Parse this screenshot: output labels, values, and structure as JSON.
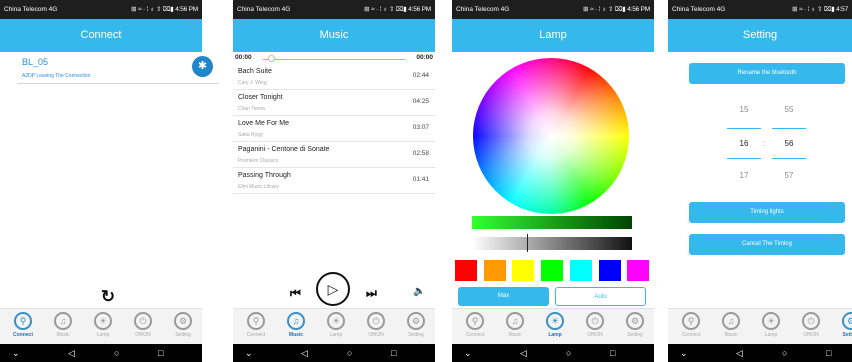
{
  "statusbar": {
    "carrier": "China Telecom 4G",
    "signal": "⊞ ≈ · ⁞ ♁ ⇧ ⌧▮",
    "time1": "4:56 PM",
    "time2": "4:56 PM",
    "time3": "4:56 PM",
    "time4": "4:57"
  },
  "connect": {
    "title": "Connect",
    "device_name": "BL_05",
    "device_status": "A2DP Leaving The Connection",
    "bluetooth_icon": "bluetooth-icon",
    "refresh_icon": "refresh-icon"
  },
  "music": {
    "title": "Music",
    "time_current": "00:00",
    "time_total": "00:00",
    "songs": [
      {
        "title": "Bach Suite",
        "artist": "Cary J. Wing",
        "duration": "02:44"
      },
      {
        "title": "Closer Tonight",
        "artist": "Chan Tenna",
        "duration": "04:25"
      },
      {
        "title": "Love Me For Me",
        "artist": "Saba Rygg",
        "duration": "03:07"
      },
      {
        "title": "Paganini - Centone di Sonate",
        "artist": "Premiere Classics",
        "duration": "02:58"
      },
      {
        "title": "Passing Through",
        "artist": "Efini Music Library",
        "duration": "01:41"
      }
    ],
    "prev_icon": "⏮",
    "play_icon": "▷",
    "next_icon": "⏭",
    "volume_icon": "🔈"
  },
  "lamp": {
    "title": "Lamp",
    "swatches": [
      "#ff0000",
      "#ff9a00",
      "#ffff00",
      "#00ff00",
      "#00ffff",
      "#0000ff",
      "#ff00ff"
    ],
    "mode_max": "Max",
    "mode_auto": "Auto"
  },
  "setting": {
    "title": "Setting",
    "rename_button": "Rename the bluetooth",
    "hours": [
      "15",
      "16",
      "17"
    ],
    "minutes": [
      "55",
      "56",
      "57"
    ],
    "separator": ":",
    "timing_button": "Timing lights",
    "cancel_button": "Cancel The Timing"
  },
  "tabs": [
    "Connect",
    "Music",
    "Lamp",
    "Off/ON",
    "Setting"
  ],
  "nav": {
    "hide": "⌄",
    "back": "◁",
    "home": "○",
    "recent": "□"
  },
  "colors": {
    "accent": "#35b9ec",
    "active_tab": "#2a6fb0",
    "progress": "#f4a640"
  }
}
